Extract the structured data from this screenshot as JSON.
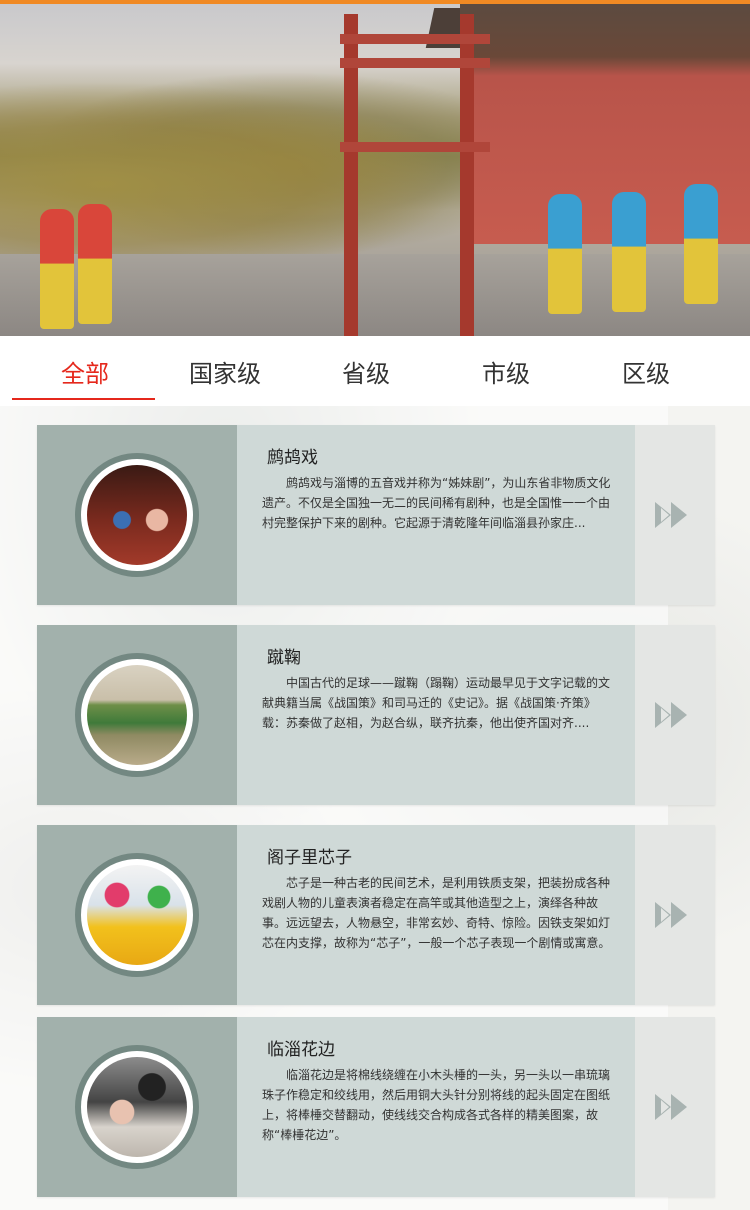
{
  "tabs": [
    {
      "label": "全部",
      "active": true
    },
    {
      "label": "国家级",
      "active": false
    },
    {
      "label": "省级",
      "active": false
    },
    {
      "label": "市级",
      "active": false
    },
    {
      "label": "区级",
      "active": false
    }
  ],
  "cards": [
    {
      "title": "鹧鸪戏",
      "desc": "鹧鸪戏与淄博的五音戏并称为“姊妹剧”，为山东省非物质文化遗产。不仅是全国独一无二的民间稀有剧种，也是全国惟一一个由村完整保护下来的剧种。它起源于清乾隆年间临淄县孙家庄..."
    },
    {
      "title": "蹴鞠",
      "desc": "中国古代的足球——蹴鞠（蹋鞠）运动最早见于文字记载的文献典籍当属《战国策》和司马迁的《史记》。据《战国策·齐策》载：苏秦做了赵相，为赵合纵，联齐抗秦，他出使齐国对齐...."
    },
    {
      "title": "阁子里芯子",
      "desc": "芯子是一种古老的民间艺术，是利用铁质支架，把装扮成各种戏剧人物的儿童表演者稳定在高竿或其他造型之上，演绎各种故事。远远望去，人物悬空，非常玄妙、奇特、惊险。因铁支架如灯芯在内支撑，故称为“芯子”，一般一个芯子表现一个剧情或寓意。"
    },
    {
      "title": "临淄花边",
      "desc": "临淄花边是将棉线绕缠在小木头棰的一头，另一头以一串琉璃珠子作稳定和绞线用，然后用铜大头针分别将线的起头固定在图纸上，将棒棰交替翻动，使线线交合构成各式各样的精美图案，故称“棒棰花边”。"
    }
  ],
  "icons": {
    "more": "double-chevron-right-icon"
  },
  "colors": {
    "accent": "#e5281c",
    "topbar": "#f08a24",
    "card": "#cfd9d7",
    "card_left": "#a2b1ac",
    "ring": "#738882"
  }
}
